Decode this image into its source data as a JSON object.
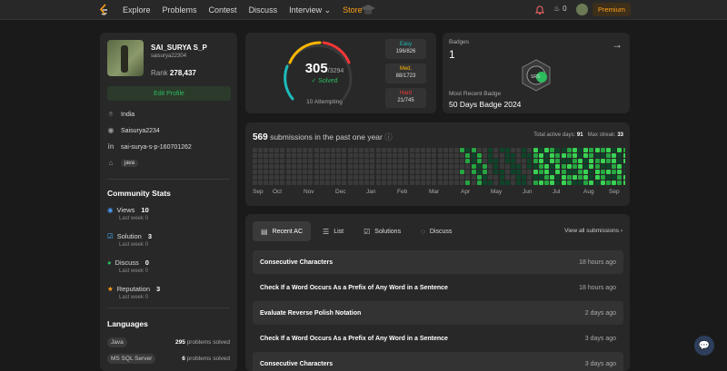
{
  "nav": {
    "links": [
      "Explore",
      "Problems",
      "Contest",
      "Discuss",
      "Interview ⌄",
      "Store ⌄"
    ],
    "fire_count": "0",
    "premium": "Premium"
  },
  "profile": {
    "username": "SAI_SURYA S_P",
    "handle": "saisurya22304",
    "rank_label": "Rank",
    "rank_value": "278,437",
    "edit_button": "Edit Profile",
    "location": "India",
    "github": "Saisurya2234",
    "linkedin": "sai-surya-s-p-160701262",
    "skill_tag": "java"
  },
  "community": {
    "title": "Community Stats",
    "stats": [
      {
        "label": "Views",
        "value": "10",
        "sub": "Last week 0",
        "color": "#4a9eff"
      },
      {
        "label": "Solution",
        "value": "3",
        "sub": "Last week 0",
        "color": "#4ab3ff"
      },
      {
        "label": "Discuss",
        "value": "0",
        "sub": "Last week 0",
        "color": "#2cbb5d"
      },
      {
        "label": "Reputation",
        "value": "3",
        "sub": "Last week 0",
        "color": "#ffa116"
      }
    ]
  },
  "languages": {
    "title": "Languages",
    "items": [
      {
        "name": "Java",
        "count": "295",
        "suffix": "problems solved"
      },
      {
        "name": "MS SQL Server",
        "count": "6",
        "suffix": "problems solved"
      }
    ]
  },
  "solved": {
    "count": "305",
    "total": "/3294",
    "label": "✓ Solved",
    "attempting": "10 Attempting",
    "easy": {
      "label": "Easy",
      "value": "196/826"
    },
    "medium": {
      "label": "Med.",
      "value": "88/1723"
    },
    "hard": {
      "label": "Hard",
      "value": "21/745"
    }
  },
  "badges": {
    "label": "Badges",
    "count": "1",
    "recent_label": "Most Recent Badge",
    "recent_name": "50 Days Badge 2024"
  },
  "heatmap": {
    "count": "569",
    "title_suffix": "submissions in the past one year",
    "active_days_label": "Total active days:",
    "active_days": "91",
    "max_streak_label": "Max streak:",
    "max_streak": "33",
    "months": [
      "Sep",
      "Oct",
      "Nov",
      "Dec",
      "Jan",
      "Feb",
      "Mar",
      "Apr",
      "May",
      "Jun",
      "Jul",
      "Aug",
      "Sep"
    ]
  },
  "submissions": {
    "tabs": [
      "Recent AC",
      "List",
      "Solutions",
      "Discuss"
    ],
    "view_all": "View all submissions ›",
    "rows": [
      {
        "name": "Consecutive Characters",
        "time": "18 hours ago"
      },
      {
        "name": "Check If a Word Occurs As a Prefix of Any Word in a Sentence",
        "time": "18 hours ago"
      },
      {
        "name": "Evaluate Reverse Polish Notation",
        "time": "2 days ago"
      },
      {
        "name": "Check If a Word Occurs As a Prefix of Any Word in a Sentence",
        "time": "3 days ago"
      },
      {
        "name": "Consecutive Characters",
        "time": "3 days ago"
      }
    ]
  }
}
